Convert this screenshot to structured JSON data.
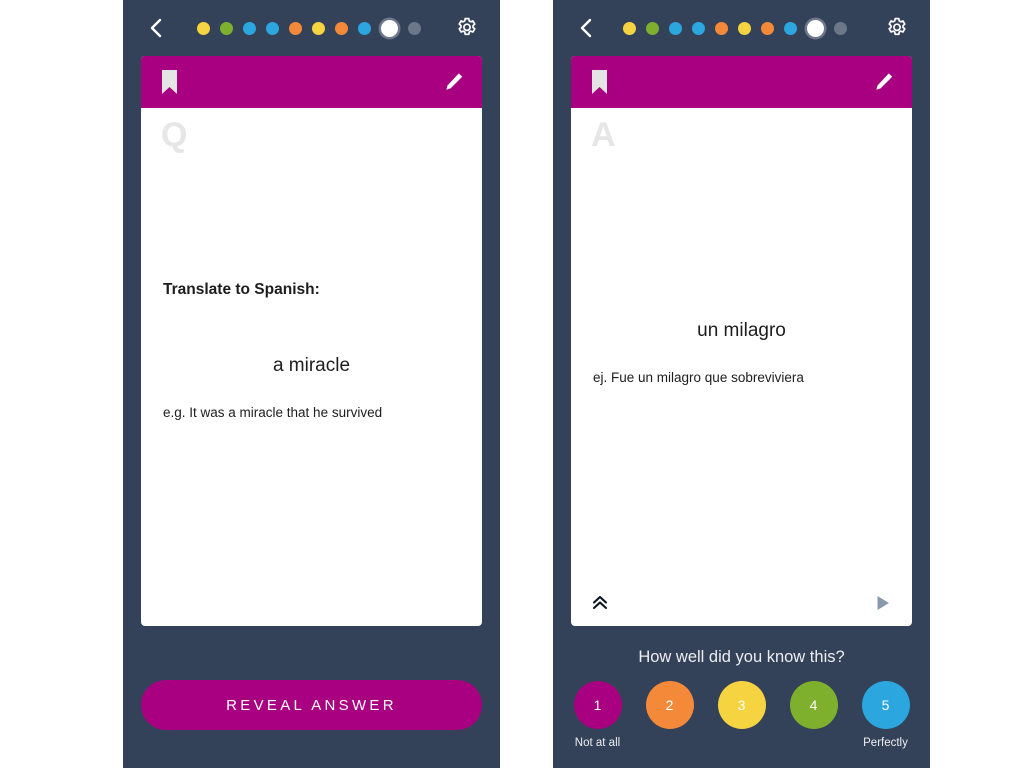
{
  "theme": {
    "panel_bg": "#334159",
    "card_header": "#A80080",
    "accent": "#A80080",
    "card_bg": "#FFFFFF",
    "page_bg": "#FFFFFF"
  },
  "question_panel": {
    "back_icon": "chevron-left-icon",
    "settings_icon": "gear-icon",
    "progress_dots": [
      {
        "color": "#F6D340",
        "state": "done"
      },
      {
        "color": "#7EB02E",
        "state": "done"
      },
      {
        "color": "#2BA6DE",
        "state": "done"
      },
      {
        "color": "#2BA6DE",
        "state": "done"
      },
      {
        "color": "#F5893A",
        "state": "done"
      },
      {
        "color": "#F6D340",
        "state": "done"
      },
      {
        "color": "#F5893A",
        "state": "done"
      },
      {
        "color": "#2BA6DE",
        "state": "done"
      },
      {
        "color": "#FFFFFF",
        "state": "current"
      },
      {
        "color": "#6C7789",
        "state": "upcoming"
      }
    ],
    "card": {
      "bookmark_icon": "bookmark-icon",
      "edit_icon": "pencil-icon",
      "watermark": "Q",
      "prompt": "Translate to Spanish:",
      "term": "a miracle",
      "example": "e.g. It was a miracle that he survived"
    },
    "reveal_label": "REVEAL ANSWER"
  },
  "answer_panel": {
    "back_icon": "chevron-left-icon",
    "settings_icon": "gear-icon",
    "progress_dots": [
      {
        "color": "#F6D340",
        "state": "done"
      },
      {
        "color": "#7EB02E",
        "state": "done"
      },
      {
        "color": "#2BA6DE",
        "state": "done"
      },
      {
        "color": "#2BA6DE",
        "state": "done"
      },
      {
        "color": "#F5893A",
        "state": "done"
      },
      {
        "color": "#F6D340",
        "state": "done"
      },
      {
        "color": "#F5893A",
        "state": "done"
      },
      {
        "color": "#2BA6DE",
        "state": "done"
      },
      {
        "color": "#FFFFFF",
        "state": "current"
      },
      {
        "color": "#6C7789",
        "state": "upcoming"
      }
    ],
    "card": {
      "bookmark_icon": "bookmark-icon",
      "edit_icon": "pencil-icon",
      "watermark": "A",
      "term": "un milagro",
      "example": "ej. Fue un milagro que sobreviviera",
      "collapse_icon": "chevron-double-up-icon",
      "play_icon": "play-icon"
    },
    "rating": {
      "question": "How well did you know this?",
      "options": [
        {
          "value": "1",
          "color": "#A80080",
          "caption": "Not at all"
        },
        {
          "value": "2",
          "color": "#F5893A",
          "caption": ""
        },
        {
          "value": "3",
          "color": "#F6D340",
          "caption": ""
        },
        {
          "value": "4",
          "color": "#7EB02E",
          "caption": ""
        },
        {
          "value": "5",
          "color": "#2BA6DE",
          "caption": "Perfectly"
        }
      ]
    }
  }
}
